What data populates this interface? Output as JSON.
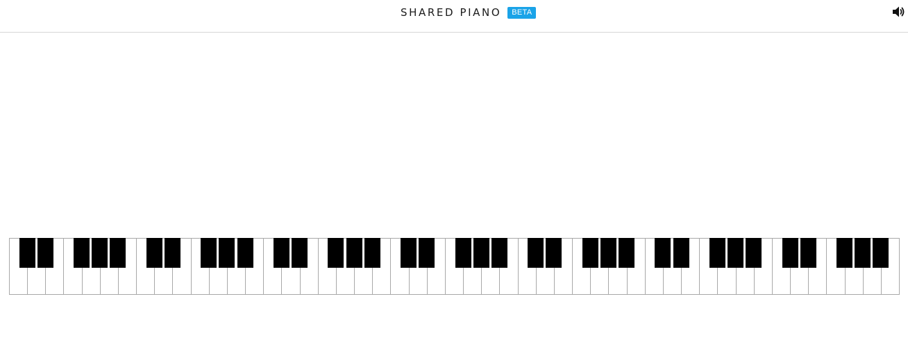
{
  "header": {
    "title": "SHARED PIANO",
    "badge": "BETA",
    "badge_color": "#1aa3e8",
    "sound_icon": "speaker-volume-icon"
  },
  "piano": {
    "white_key_count": 49,
    "octaves": 7,
    "white_key_color": "#ffffff",
    "black_key_color": "#000000",
    "key_border_color": "#a8a8a8",
    "first_note": "C",
    "last_note": "B"
  }
}
